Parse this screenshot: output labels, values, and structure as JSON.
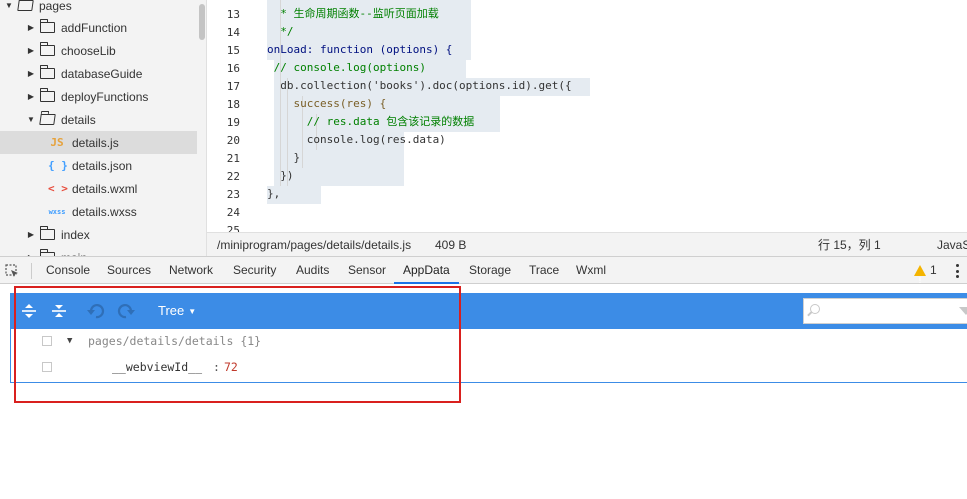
{
  "file_tree": {
    "items": [
      {
        "label": "pages",
        "kind": "folder",
        "open": true,
        "level": 0
      },
      {
        "label": "addFunction",
        "kind": "folder",
        "open": false,
        "level": 1
      },
      {
        "label": "chooseLib",
        "kind": "folder",
        "open": false,
        "level": 1
      },
      {
        "label": "databaseGuide",
        "kind": "folder",
        "open": false,
        "level": 1
      },
      {
        "label": "deployFunctions",
        "kind": "folder",
        "open": false,
        "level": 1
      },
      {
        "label": "details",
        "kind": "folder",
        "open": true,
        "level": 1
      },
      {
        "label": "details.js",
        "kind": "js",
        "icon_text": "JS",
        "level": 2,
        "selected": true
      },
      {
        "label": "details.json",
        "kind": "json",
        "icon_text": "{ }",
        "level": 2
      },
      {
        "label": "details.wxml",
        "kind": "wxml",
        "icon_text": "< >",
        "level": 2
      },
      {
        "label": "details.wxss",
        "kind": "wxss",
        "icon_text": "wxss",
        "level": 2
      },
      {
        "label": "index",
        "kind": "folder",
        "open": false,
        "level": 1
      },
      {
        "label": "main",
        "kind": "folder",
        "open": false,
        "level": 1
      }
    ]
  },
  "editor": {
    "lines": [
      {
        "num": "13",
        "text": "  * 生命周期函数--监听页面加载"
      },
      {
        "num": "14",
        "text": "  */"
      },
      {
        "num": "15",
        "text": "onLoad: function (options) {"
      },
      {
        "num": "16",
        "text": " // console.log(options)"
      },
      {
        "num": "17",
        "text": "  db.collection('books').doc(options.id).get({"
      },
      {
        "num": "18",
        "text": "    success(res) {"
      },
      {
        "num": "19",
        "text": "      // res.data 包含该记录的数据"
      },
      {
        "num": "20",
        "text": "      console.log(res.data)"
      },
      {
        "num": "21",
        "text": "    }"
      },
      {
        "num": "22",
        "text": "  })"
      },
      {
        "num": "23",
        "text": "},"
      },
      {
        "num": "24",
        "text": ""
      },
      {
        "num": "25",
        "text": ""
      }
    ]
  },
  "status_bar": {
    "path": "/miniprogram/pages/details/details.js",
    "size": "409 B",
    "cursor": "行 15，列 1",
    "language": "JavaScript"
  },
  "devtools": {
    "tabs": [
      "Console",
      "Sources",
      "Network",
      "Security",
      "Audits",
      "Sensor",
      "AppData",
      "Storage",
      "Trace",
      "Wxml"
    ],
    "active_tab": "AppData",
    "warning_count": "1"
  },
  "appdata": {
    "mode": "Tree",
    "search_placeholder": "",
    "root_path": "pages/details/details {1}",
    "entries": [
      {
        "key": "__webviewId__",
        "value": "72"
      }
    ]
  },
  "colors": {
    "toolbar_blue": "#3c8ce6",
    "highlight_red": "#d9201e",
    "value_red": "#c0392b",
    "comment_green": "#008000",
    "keyword_blue": "#0000ff"
  }
}
